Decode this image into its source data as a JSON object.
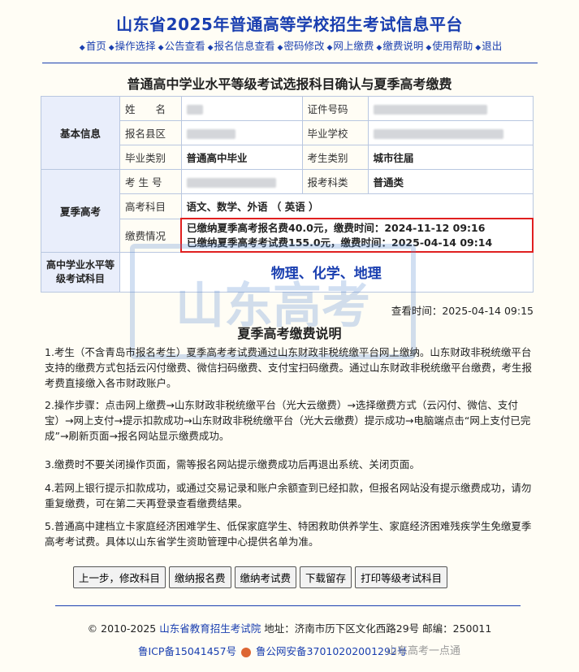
{
  "header": {
    "site_title": "山东省2025年普通高等学校招生考试信息平台",
    "nav": [
      "首页",
      "操作选择",
      "公告查看",
      "报名信息查看",
      "密码修改",
      "网上缴费",
      "缴费说明",
      "使用帮助",
      "退出"
    ]
  },
  "page_title": "普通高中学业水平等级考试选报科目确认与夏季高考缴费",
  "basic_info": {
    "section_label": "基本信息",
    "name_label": "姓　　名",
    "id_label": "证件号码",
    "county_label": "报名县区",
    "school_label": "毕业学校",
    "grad_type_label": "毕业类别",
    "grad_type_value": "普通高中毕业",
    "candidate_type_label": "考生类别",
    "candidate_type_value": "城市往届"
  },
  "summer_exam": {
    "section_label": "夏季高考",
    "exam_no_label": "考 生 号",
    "subject_type_label": "报考科类",
    "subject_type_value": "普通类",
    "subjects_label": "高考科目",
    "subjects_value": "语文、数学、外语 （ 英语 ）",
    "payment_label": "缴费情况",
    "payment_line1": "已缴纳夏季高考报名费40.0元，缴费时间：2024-11-12 09:16",
    "payment_line2": "已缴纳夏季高考考试费155.0元，缴费时间：2025-04-14 09:14"
  },
  "level_exam": {
    "section_label": "高中学业水平等级考试科目",
    "subjects": "物理、化学、地理"
  },
  "query_time": "查看时间：2025-04-14 09:15",
  "explain": {
    "title": "夏季高考缴费说明",
    "p1": "1.考生（不含青岛市报名考生）夏季高考考试费通过山东财政非税统缴平台网上缴纳。山东财政非税统缴平台支持的缴费方式包括云闪付缴费、微信扫码缴费、支付宝扫码缴费。通过山东财政非税统缴平台缴费，考生报考费直接缴入各市财政账户。",
    "p2": "2.操作步骤：点击网上缴费→山东财政非税统缴平台（光大云缴费）→选择缴费方式（云闪付、微信、支付宝）→网上支付→提示扣款成功→山东财政非税统缴平台（光大云缴费）提示成功→电脑端点击“网上支付已完成”→刷新页面→报名网站显示缴费成功。",
    "p3": "3.缴费时不要关闭操作页面，需等报名网站提示缴费成功后再退出系统、关闭页面。",
    "p4": "4.若网上银行提示扣款成功，或通过交易记录和账户余额查到已经扣款，但报名网站没有提示缴费成功，请勿重复缴费，可在第二天再登录查看缴费结果。",
    "p5": "5.普通高中建档立卡家庭经济困难学生、低保家庭学生、特困救助供养学生、家庭经济困难残疾学生免缴夏季高考考试费。具体以山东省学生资助管理中心提供名单为准。"
  },
  "buttons": [
    "上一步，修改科目",
    "缴纳报名费",
    "缴纳考试费",
    "下载留存",
    "打印等级考试科目"
  ],
  "footer": {
    "copyright": "© 2010-2025",
    "org": "山东省教育招生考试院",
    "address": "地址：济南市历下区文化西路29号 邮编：250011",
    "icp": "鲁ICP备15041457号",
    "police": "鲁公网安备37010202001292号",
    "watermark_text": "山东高考一点通"
  },
  "colors": {
    "accent": "#1a3fb0",
    "highlight_border": "#e02020",
    "section_bg": "#e9eefb"
  }
}
